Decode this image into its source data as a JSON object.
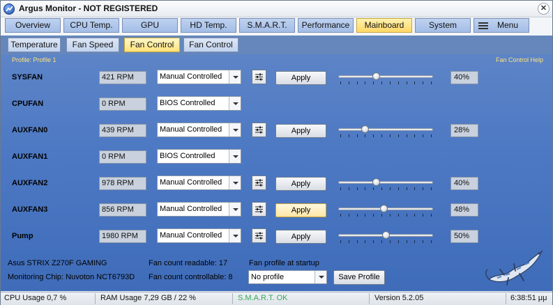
{
  "window": {
    "title": "Argus Monitor - NOT REGISTERED",
    "close_glyph": "✕"
  },
  "main_tabs": [
    {
      "label": "Overview"
    },
    {
      "label": "CPU Temp."
    },
    {
      "label": "GPU"
    },
    {
      "label": "HD Temp."
    },
    {
      "label": "S.M.A.R.T."
    },
    {
      "label": "Performance"
    },
    {
      "label": "Mainboard",
      "active": true
    },
    {
      "label": "System"
    },
    {
      "label": "Menu",
      "icon": "menu-icon"
    }
  ],
  "sub_tabs": [
    {
      "label": "Temperature"
    },
    {
      "label": "Fan Speed"
    },
    {
      "label": "Fan Control",
      "active": true
    },
    {
      "label": "Fan Control"
    }
  ],
  "profile_label": "Profile: Profile 1",
  "help_link": "Fan Control Help",
  "fans": [
    {
      "name": "SYSFAN",
      "rpm": "421 RPM",
      "mode": "Manual Controlled",
      "apply": "Apply",
      "percent_label": "40%",
      "percent": 40
    },
    {
      "name": "CPUFAN",
      "rpm": "0 RPM",
      "mode": "BIOS Controlled"
    },
    {
      "name": "AUXFAN0",
      "rpm": "439 RPM",
      "mode": "Manual Controlled",
      "apply": "Apply",
      "percent_label": "28%",
      "percent": 28
    },
    {
      "name": "AUXFAN1",
      "rpm": "0 RPM",
      "mode": "BIOS Controlled"
    },
    {
      "name": "AUXFAN2",
      "rpm": "978 RPM",
      "mode": "Manual Controlled",
      "apply": "Apply",
      "percent_label": "40%",
      "percent": 40
    },
    {
      "name": "AUXFAN3",
      "rpm": "856 RPM",
      "mode": "Manual Controlled",
      "apply": "Apply",
      "percent_label": "48%",
      "percent": 48,
      "apply_hover": true
    },
    {
      "name": "Pump",
      "rpm": "1980 RPM",
      "mode": "Manual Controlled",
      "apply": "Apply",
      "percent_label": "50%",
      "percent": 50
    }
  ],
  "footer_info": {
    "board": "Asus STRIX Z270F GAMING",
    "chip": "Monitoring Chip: Nuvoton NCT6793D",
    "readable": "Fan count readable: 17",
    "controllable": "Fan count controllable: 8",
    "startup_label": "Fan profile at startup",
    "startup_value": "No profile",
    "save_button": "Save Profile"
  },
  "status": {
    "cpu": "CPU Usage 0,7 %",
    "ram": "RAM Usage 7,29 GB / 22 %",
    "smart": "S.M.A.R.T. OK",
    "version": "Version 5.2.05",
    "time": "6:38:51 μμ"
  },
  "colors": {
    "accent_tab": "#ffd766",
    "panel": "#4d79c4",
    "smart_ok": "#3aa657",
    "profile_text": "#ffe27a"
  }
}
